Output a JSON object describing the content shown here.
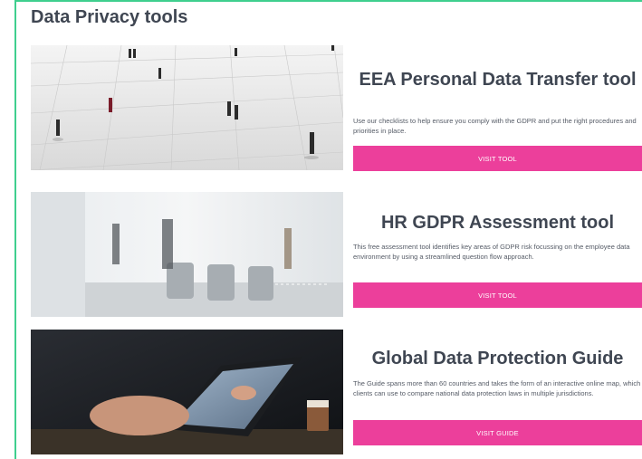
{
  "section": {
    "title": "Data Privacy tools"
  },
  "cards": [
    {
      "title": "EEA Personal Data Transfer tool",
      "description": "Use our checklists to help ensure you comply with the GDPR and put the right procedures and priorities in place.",
      "button": "VISIT TOOL"
    },
    {
      "title": "HR GDPR Assessment tool",
      "description": "This free assessment tool identifies key areas of GDPR risk focussing on the employee data environment by using a streamlined question flow approach.",
      "button": "VISIT TOOL"
    },
    {
      "title": "Global Data Protection Guide",
      "description": "The Guide spans more than 60 countries and takes the form of an interactive online map, which clients can use to compare national data protection laws in multiple jurisdictions.",
      "button": "VISIT GUIDE"
    }
  ],
  "colors": {
    "accent": "#ec3f9b",
    "frame": "#3fcf8e",
    "heading": "#3f4652"
  }
}
